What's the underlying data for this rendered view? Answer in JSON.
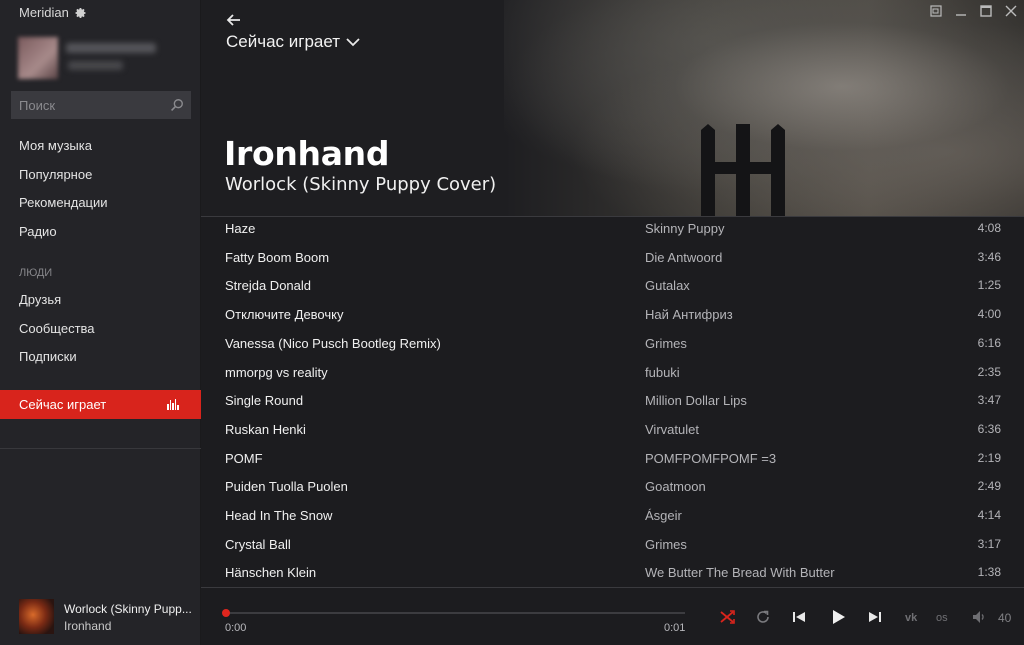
{
  "app": {
    "title": "Meridian"
  },
  "search": {
    "placeholder": "Поиск"
  },
  "sidebar": {
    "music_items": [
      {
        "label": "Моя музыка"
      },
      {
        "label": "Популярное"
      },
      {
        "label": "Рекомендации"
      },
      {
        "label": "Радио"
      }
    ],
    "people_section": "ЛЮДИ",
    "people_items": [
      {
        "label": "Друзья"
      },
      {
        "label": "Сообщества"
      },
      {
        "label": "Подписки"
      }
    ],
    "now_playing_label": "Сейчас играет"
  },
  "header": {
    "view_title": "Сейчас играет",
    "artist": "Ironhand",
    "track": "Worlock (Skinny Puppy Cover)"
  },
  "tracks": [
    {
      "title": "Haze",
      "artist": "Skinny Puppy",
      "duration": "4:08"
    },
    {
      "title": "Fatty Boom Boom",
      "artist": "Die Antwoord",
      "duration": "3:46"
    },
    {
      "title": "Strejda Donald",
      "artist": "Gutalax",
      "duration": "1:25"
    },
    {
      "title": "Отключите Девочку",
      "artist": "Най Антифриз",
      "duration": "4:00"
    },
    {
      "title": "Vanessa (Nico Pusch Bootleg Remix)",
      "artist": "Grimes",
      "duration": "6:16"
    },
    {
      "title": "mmorpg vs reality",
      "artist": "fubuki",
      "duration": "2:35"
    },
    {
      "title": "Single Round",
      "artist": "Million Dollar Lips",
      "duration": "3:47"
    },
    {
      "title": "Ruskan Henki",
      "artist": "Virvatulet",
      "duration": "6:36"
    },
    {
      "title": "POMF",
      "artist": "POMFPOMFPOMF =3",
      "duration": "2:19"
    },
    {
      "title": "Puiden Tuolla Puolen",
      "artist": "Goatmoon",
      "duration": "2:49"
    },
    {
      "title": "Head In The Snow",
      "artist": "Ásgeir",
      "duration": "4:14"
    },
    {
      "title": "Crystal Ball",
      "artist": "Grimes",
      "duration": "3:17"
    },
    {
      "title": "Hänschen Klein",
      "artist": "We Butter The Bread With Butter",
      "duration": "1:38"
    }
  ],
  "mini_player": {
    "title": "Worlock (Skinny Pupp...",
    "artist": "Ironhand"
  },
  "player": {
    "current_time": "0:00",
    "total_time": "0:01",
    "progress_fraction": 0.0,
    "vk_label": "vk",
    "os_label": "os",
    "volume": "40"
  },
  "colors": {
    "accent": "#d8241c",
    "sidebar_bg": "#242428",
    "main_bg": "#1c1c1f"
  },
  "icons": {
    "settings": "gear-icon",
    "search": "search-icon",
    "back": "back-arrow-icon",
    "dropdown": "chevron-down-icon",
    "equalizer": "equalizer-icon",
    "shuffle": "shuffle-icon",
    "repeat": "repeat-icon",
    "previous": "previous-icon",
    "play": "play-icon",
    "next": "next-icon",
    "volume": "volume-icon"
  }
}
